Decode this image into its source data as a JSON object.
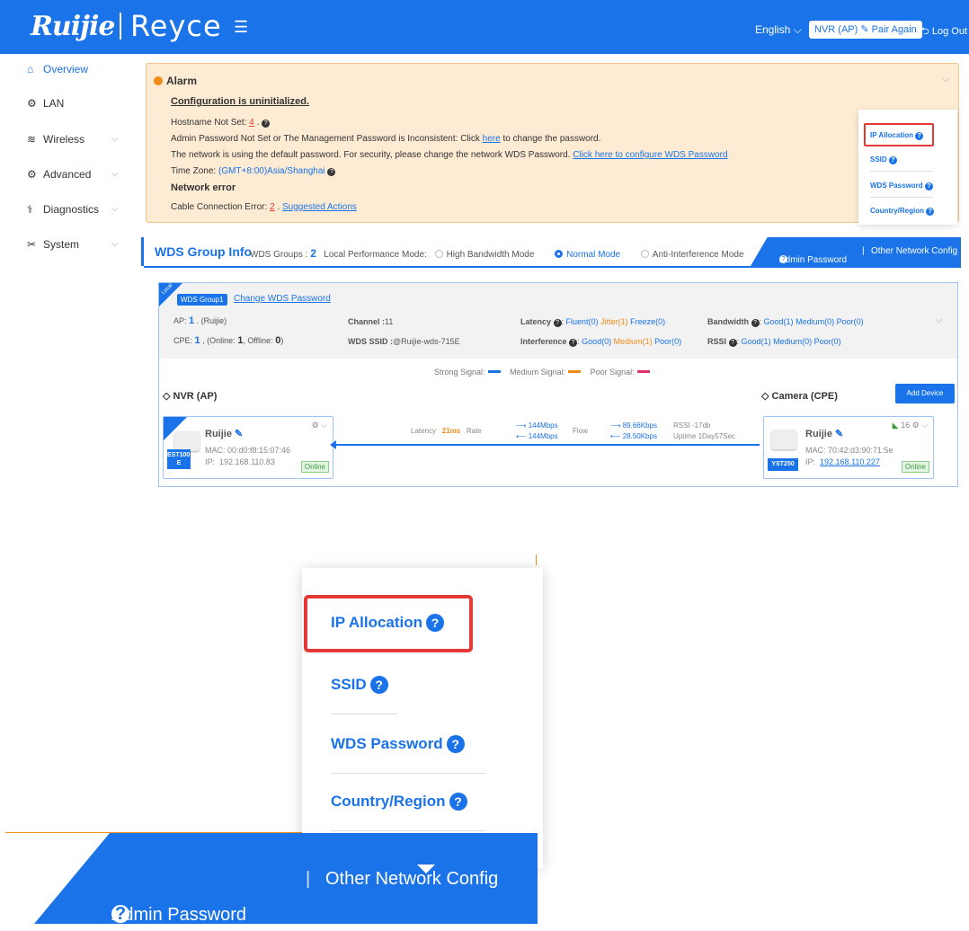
{
  "header": {
    "logo_primary": "Ruijie",
    "logo_secondary": "Reyce",
    "menu_icon": "menu-collapse-icon",
    "language": "English",
    "device_label": "NVR (AP)",
    "pair_again": "Pair Again",
    "logout": "Log Out",
    "accent_color": "#1a73e8"
  },
  "sidebar": {
    "items": [
      {
        "label": "Overview",
        "icon": "home-icon",
        "active": true
      },
      {
        "label": "LAN",
        "icon": "gear-icon"
      },
      {
        "label": "Wireless",
        "icon": "wifi-icon",
        "expandable": true
      },
      {
        "label": "Advanced",
        "icon": "settings-icon",
        "expandable": true
      },
      {
        "label": "Diagnostics",
        "icon": "stethoscope-icon",
        "expandable": true
      },
      {
        "label": "System",
        "icon": "tools-icon",
        "expandable": true
      }
    ]
  },
  "alarm": {
    "title": "Alarm",
    "config_heading": "Configuration is uninitialized.",
    "hostname_prefix": "Hostname Not Set:",
    "hostname_count": "4",
    "admin_pw_prefix": "Admin Password Not Set or The Management Password is Inconsistent: Click",
    "admin_pw_link": "here",
    "admin_pw_suffix": "to change the password.",
    "wds_pw_prefix": "The network is using the default password. For security, please change the network WDS Password.",
    "wds_pw_link": "Click here to configure WDS Password",
    "tz_prefix": "Time Zone:",
    "tz_value": "(GMT+8:00)Asia/Shanghai",
    "network_heading": "Network error",
    "cable_prefix": "Cable Connection Error:",
    "cable_count": "2",
    "cable_link": "Suggested Actions"
  },
  "float_menu": {
    "items": [
      "IP Allocation",
      "SSID",
      "WDS Password",
      "Country/Region"
    ]
  },
  "wds": {
    "title": "WDS Group Info",
    "groups_label": "WDS Groups :",
    "groups_count": "2",
    "mode_label": "Local Performance Mode:",
    "modes": [
      "High Bandwidth Mode",
      "Normal Mode",
      "Anti-Interference Mode"
    ],
    "selected_mode": "Normal Mode",
    "tab_admin": "Admin Password",
    "tab_other": "Other Network Config"
  },
  "group": {
    "local_tag": "Local",
    "badge": "WDS Group1",
    "change_link": "Change WDS Password",
    "ap_label": "AP:",
    "ap_count": "1",
    "ap_brand": "(Ruijie)",
    "cpe_label": "CPE:",
    "cpe_count": "1",
    "cpe_online_label": "(Online:",
    "cpe_online": "1",
    "cpe_offline_label": ", Offline:",
    "cpe_offline": "0",
    "channel_label": "Channel :",
    "channel": "11",
    "ssid_label": "WDS SSID :",
    "ssid": "@Ruijie-wds-715E",
    "latency_label": "Latency",
    "latency_fluent": "Fluent(0)",
    "latency_jitter": "Jitter(1)",
    "latency_freeze": "Freeze(0)",
    "interference_label": "Interference",
    "int_good": "Good(0)",
    "int_medium": "Medium(1)",
    "int_poor": "Poor(0)",
    "bandwidth_label": "Bandwidth",
    "bw_good": "Good(1)",
    "bw_medium": "Medium(0)",
    "bw_poor": "Poor(0)",
    "rssi_label": "RSSI",
    "rssi_good": "Good(1)",
    "rssi_medium": "Medium(0)",
    "rssi_poor": "Poor(0)",
    "legend": [
      {
        "label": "Strong Signal:",
        "color": "#1a73e8"
      },
      {
        "label": "Medium Signal:",
        "color": "#f08c1a"
      },
      {
        "label": "Poor Signal:",
        "color": "#e0336e"
      }
    ],
    "ap_title": "NVR (AP)",
    "cpe_title": "Camera (CPE)",
    "add_device": "Add Device"
  },
  "ap_device": {
    "name": "Ruijie",
    "model": "EST100-E",
    "mac": "MAC:  00:d0:f8:15:07:46",
    "ip_label": "IP:",
    "ip": "192.168.110.83",
    "status": "Online"
  },
  "cpe_device": {
    "name": "Ruijie",
    "model": "YST250",
    "mac": "MAC:  70:42:d3:90:71:5e",
    "ip_label": "IP:",
    "ip": "192.168.110.227",
    "status": "Online",
    "client_count": "16"
  },
  "link": {
    "latency_label": "Latency",
    "latency": "21ms",
    "rate_label": "Rate",
    "rate_up": "144Mbps",
    "rate_down": "144Mbps",
    "flow_label": "Flow",
    "flow_up": "89.66Kbps",
    "flow_down": "28.50Kbps",
    "rssi": "RSSI -17db",
    "uptime": "Uptime 1Day57Sec"
  },
  "zoom": {
    "items": [
      "IP Allocation",
      "SSID",
      "WDS Password",
      "Country/Region"
    ],
    "bar_admin": "Admin Password",
    "bar_other": "Other Network Config"
  }
}
